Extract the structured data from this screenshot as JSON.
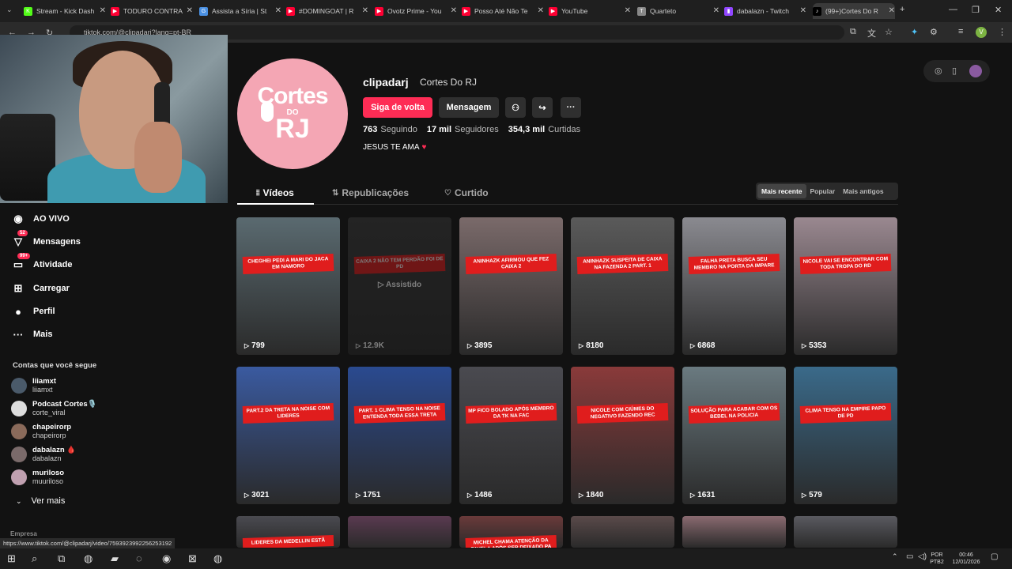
{
  "browser": {
    "tabs": [
      {
        "title": "Stream - Kick Dash",
        "color": "#53fc18",
        "glyph": "K"
      },
      {
        "title": "TODURO CONTRA",
        "color": "#ff0033",
        "glyph": "▶"
      },
      {
        "title": "Assista a Síria | St",
        "color": "#4a90e2",
        "glyph": "G"
      },
      {
        "title": "#DOMINGOAT | R",
        "color": "#ff0033",
        "glyph": "▶"
      },
      {
        "title": "Ovotz Prime - You",
        "color": "#ff0033",
        "glyph": "▶"
      },
      {
        "title": "Posso Até Não Te",
        "color": "#ff0033",
        "glyph": "▶"
      },
      {
        "title": "YouTube",
        "color": "#ff0033",
        "glyph": "▶"
      },
      {
        "title": "Quarteto",
        "color": "#888888",
        "glyph": "T"
      },
      {
        "title": "dabalazn - Twitch",
        "color": "#9146ff",
        "glyph": "▮"
      },
      {
        "title": "(99+)Cortes Do R",
        "color": "#000000",
        "glyph": "♪"
      }
    ],
    "new_tab": "+",
    "url": "tiktok.com/@clipadarj?lang=pt-BR",
    "minimize": "—",
    "restore": "❐",
    "close": "✕",
    "profile_letter": "V"
  },
  "profile": {
    "avatar_line1": "Cortes",
    "avatar_line2": "RJ",
    "avatar_do": "DO",
    "username": "clipadarj",
    "nickname": "Cortes Do RJ",
    "follow_label": "Siga de volta",
    "message_label": "Mensagem",
    "more_label": "···",
    "following_count": "763",
    "following_label": "Seguindo",
    "followers_count": "17 mil",
    "followers_label": "Seguidores",
    "likes_count": "354,3 mil",
    "likes_label": "Curtidas",
    "bio": "JESUS TE AMA",
    "bio_heart": "♥"
  },
  "tabs": {
    "videos": "Vídeos",
    "reposts": "Republicações",
    "liked": "Curtido"
  },
  "sort": {
    "recent": "Mais recente",
    "popular": "Popular",
    "oldest": "Mais antigos"
  },
  "sidebar": {
    "nav": [
      {
        "label": "AO VIVO",
        "icon": "◉"
      },
      {
        "label": "Mensagens",
        "icon": "▽",
        "badge": "52"
      },
      {
        "label": "Atividade",
        "icon": "▭",
        "badge": "99+"
      },
      {
        "label": "Carregar",
        "icon": "⊞"
      },
      {
        "label": "Perfil",
        "icon": "●"
      },
      {
        "label": "Mais",
        "icon": "···"
      }
    ],
    "following_header": "Contas que você segue",
    "following": [
      {
        "name": "liiamxt",
        "handle": "liiamxt",
        "color": "#4a5a6a"
      },
      {
        "name": "Podcast Cortes🎙️",
        "handle": "corte_viral",
        "color": "#dddddd"
      },
      {
        "name": "chapeirorp",
        "handle": "chapeirorp",
        "color": "#8a6a5a"
      },
      {
        "name": "dabalazn 🩸",
        "handle": "dabalazn",
        "color": "#7a6a6a"
      },
      {
        "name": "muriloso",
        "handle": "muuriloso",
        "color": "#c0a0b0"
      }
    ],
    "see_more": "Ver mais",
    "company": "Empresa"
  },
  "status_url": "https://www.tiktok.com/@clipadarj/video/7593923992256253192",
  "videos": [
    {
      "views": "799",
      "caption": "CHEGHEI PEDI A MARI DO JACA EM NAMORO",
      "bg": "#5a6a70"
    },
    {
      "views": "12.9K",
      "caption": "CAIXA 2 NÃO TEM PERDÃO FOI DE PD",
      "bg": "#3a3a3a",
      "watched": "Assistido"
    },
    {
      "views": "3895",
      "caption": "ANINHAZK AFIRMOU QUE FEZ CAIXA 2",
      "bg": "#7a6a6a"
    },
    {
      "views": "8180",
      "caption": "ANINHAZK SUSPEITA DE CAIXA NA FAZENDA 2 PART. 1",
      "bg": "#5a5a5a"
    },
    {
      "views": "6868",
      "caption": "FALHA PRETA BUSCA SEU MEMBRO NA PORTA DA IMPARE",
      "bg": "#8a8a90"
    },
    {
      "views": "5353",
      "caption": "NICOLE VAI SE ENCONTRAR COM TODA TROPA DO RD",
      "bg": "#9a8890"
    },
    {
      "views": "3021",
      "caption": "PART.2 DA TRETA NA NOISE COM LIDERES",
      "bg": "#3a5aa0"
    },
    {
      "views": "1751",
      "caption": "PART. 1 CLIMA TENSO NA NOISE ENTENDA TODA ESSA TRETA",
      "bg": "#2a4a90"
    },
    {
      "views": "1486",
      "caption": "MP FICO BOLADO APÓS MEMBRO DA TK NA FAC",
      "bg": "#4a4a50"
    },
    {
      "views": "1840",
      "caption": "NICOLE COM CIÚMES DO NEGATIVO FAZENDO REC",
      "bg": "#8a3a3a"
    },
    {
      "views": "1631",
      "caption": "SOLUÇÃO PARA ACABAR COM OS BEBEL NA POLICIA",
      "bg": "#6a7a80"
    },
    {
      "views": "579",
      "caption": "CLIMA TENSO NA EMPIRE PAPO DE PD",
      "bg": "#3a6a8a"
    },
    {
      "views": "",
      "caption": "LIDERES DA MEDELLIN ESTÃ",
      "bg": "#4a4a50"
    },
    {
      "views": "",
      "caption": "",
      "bg": "#5a3a50"
    },
    {
      "views": "",
      "caption": "MICHEL CHAMA ATENÇÃO DA FAVELA APÓS SER DEIXADO PA TRÁS",
      "bg": "#6a3a3a"
    },
    {
      "views": "",
      "caption": "",
      "bg": "#5a4a4a"
    },
    {
      "views": "",
      "caption": "",
      "bg": "#8a6a70"
    },
    {
      "views": "",
      "caption": "",
      "bg": "#5a5a60"
    }
  ],
  "taskbar": {
    "lang": "POR",
    "layout": "PTB2",
    "time": "00:46",
    "date": "12/01/2026"
  },
  "colors": {
    "accent": "#fe2c55",
    "bg": "#121212"
  }
}
